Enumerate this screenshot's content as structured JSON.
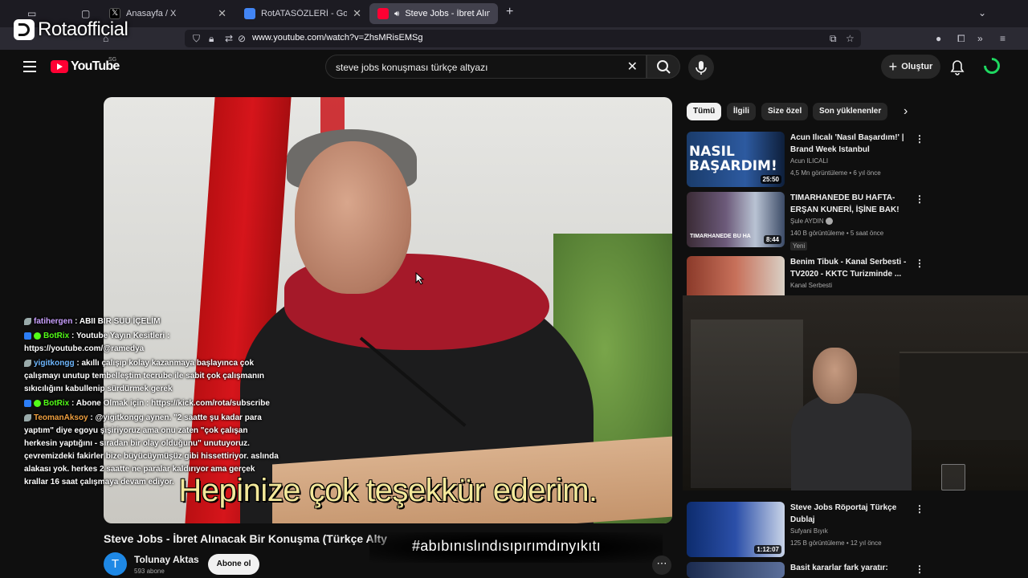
{
  "browser": {
    "tabs": [
      {
        "title": "",
        "active": false
      },
      {
        "title": "Anasayfa / X",
        "active": false
      },
      {
        "title": "RotATASÖZLERİ - Google Dokü",
        "active": false
      },
      {
        "title": "Steve Jobs - İbret Alınacak",
        "active": true
      }
    ],
    "url": "www.youtube.com/watch?v=ZhsMRisEMSg"
  },
  "overlay": {
    "streamer_logo": "Rotaofficial",
    "hashtag": "#abıbınıslındısıpırımdınyıkıtı"
  },
  "youtube": {
    "logo_text": "YouTube",
    "country": "SG",
    "search_query": "steve jobs konuşması türkçe altyazı",
    "create_label": "Oluştur",
    "accent": "#ff0033"
  },
  "video": {
    "subtitle": "Hepinize çok teşekkür ederim.",
    "title": "Steve Jobs - İbret Alınacak Bir Konuşma (Türkçe Alty",
    "channel": "Tolunay Aktas",
    "channel_initial": "T",
    "subscribers": "593 abone",
    "subscribe_label": "Abone ol"
  },
  "chat": [
    {
      "user": "fatihergen",
      "color": "#c9a0ff",
      "text": ": ABII BIR SUU İÇELİM",
      "badges": [
        "leaf"
      ]
    },
    {
      "user": "BotRix",
      "color": "#53fc18",
      "text": ": Youtube Yayın Kesitleri : https://youtube.com/@ramedya",
      "badges": [
        "blue",
        "green"
      ]
    },
    {
      "user": "yigitkongg",
      "color": "#6fb8ff",
      "text": ": akıllı çalışıp kolay kazanmaya başlayınca çok çalışmayı unutup tembelleştim tecrube ile sabit çok çalışmanın sıkıcılığını kabullenip sürdürmek gerek",
      "badges": [
        "leaf"
      ]
    },
    {
      "user": "BotRix",
      "color": "#53fc18",
      "text": ": Abone Olmak için : https://kick.com/rota/subscribe",
      "badges": [
        "blue",
        "green"
      ]
    },
    {
      "user": "TeomanAksoy",
      "color": "#f0a040",
      "text": ": @yigitkongg aynen. \"2 saatte şu kadar para yaptım\" diye egoyu şişiriyoruz ama onu zaten \"çok çalışan herkesin yaptığını - sıradan bir olay olduğunu\" unutuyoruz. çevremizdeki fakirler bize büyücüymüşüz gibi hissettiriyor. aslında alakası yok. herkes 2 saatte ne paralar kaldırıyor ama gerçek krallar 16 saat çalışmaya devam ediyor.",
      "badges": [
        "leaf"
      ]
    }
  ],
  "chips": [
    "Tümü",
    "İlgili",
    "Size özel",
    "Son yüklenenler"
  ],
  "related": [
    {
      "title": "Acun Ilıcalı 'Nasıl Başardım!' | Brand Week Istanbul",
      "channel": "Acun ILICALI",
      "meta": "4,5 Mn görüntüleme • 6 yıl önce",
      "duration": "25:50",
      "thumb_text": "NASIL BAŞARDIM!"
    },
    {
      "title": "TIMARHANEDE BU HAFTA- ERŞAN KUNERİ, İŞİNE BAK!",
      "channel": "Şule AYDIN",
      "meta": "140 B görüntüleme • 5 saat önce",
      "duration": "8:44",
      "badge": "Yeni",
      "thumb_text": "TIMARHANEDE BU HA"
    },
    {
      "title": "Benim Tibuk - Kanal Serbesti - TV2020 - KKTC Turizminde ...",
      "channel": "Kanal Serbesti",
      "meta": "",
      "duration": ""
    },
    {
      "title": "Steve Jobs Röportaj Türkçe Dublaj",
      "channel": "Sufyani Bıyık",
      "meta": "125 B görüntüleme • 12 yıl önce",
      "duration": "1:12:07"
    },
    {
      "title": "Basit kararlar fark yaratır:",
      "channel": "",
      "meta": "",
      "duration": ""
    }
  ]
}
